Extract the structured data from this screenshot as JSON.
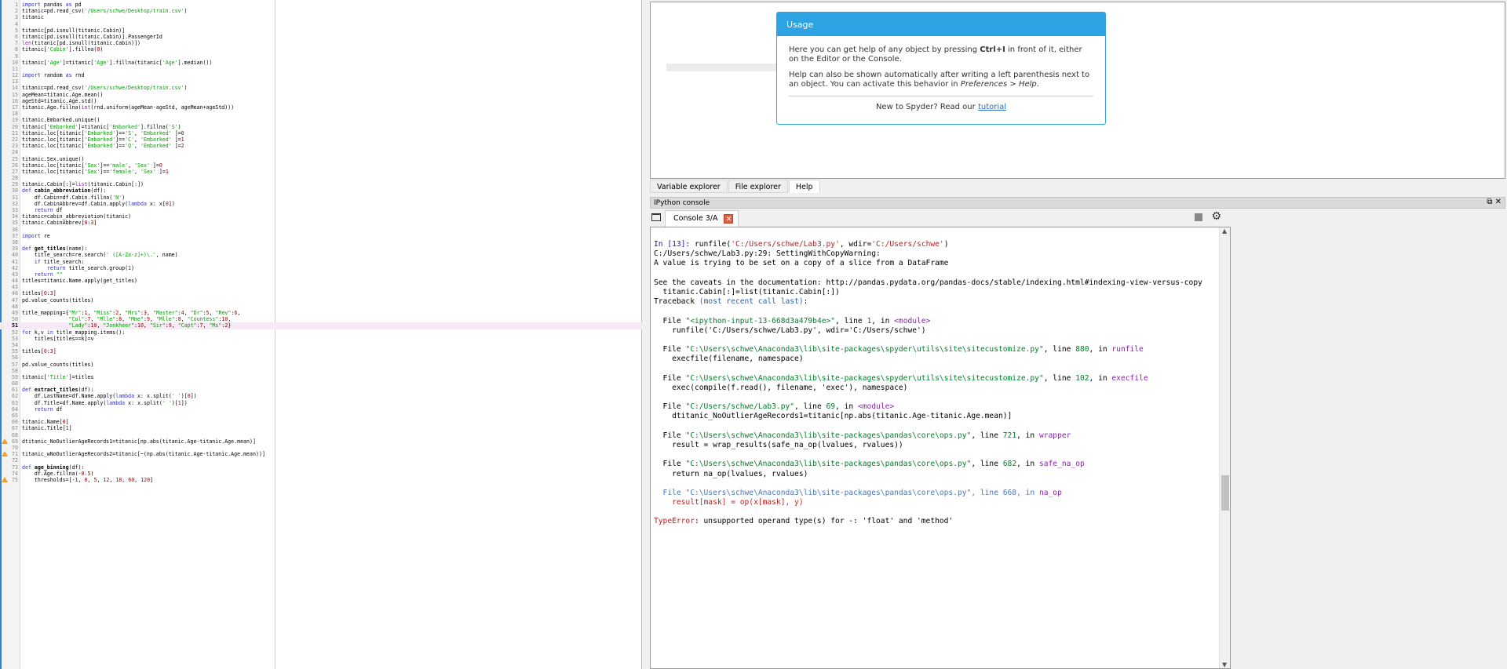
{
  "editor": {
    "current_line": 51,
    "warning_lines": [
      69,
      71,
      75
    ],
    "lines": [
      "import pandas as pd",
      "titanic=pd.read_csv('/Users/schwe/Desktop/train.csv')",
      "titanic",
      "",
      "titanic[pd.isnull(titanic.Cabin)]",
      "titanic[pd.isnull(titanic.Cabin)].PassengerId",
      "len(titanic[pd.isnull(titanic.Cabin)])",
      "titanic['Cabin'].fillna(0)",
      "",
      "titanic['Age']=titanic['Age'].fillna(titanic['Age'].median())",
      "",
      "import random as rnd",
      "",
      "titanic=pd.read_csv('/Users/schwe/Desktop/train.csv')",
      "ageMean=titanic.Age.mean()",
      "ageStd=titanic.Age.std()",
      "titanic.Age.fillna(int(rnd.uniform(ageMean-ageStd, ageMean+ageStd)))",
      "",
      "titanic.Embarked.unique()",
      "titanic['Embarked']=titanic['Embarked'].fillna('S')",
      "titanic.loc[titanic['Embarked']=='S', 'Embarked' ]=0",
      "titanic.loc[titanic['Embarked']=='C', 'Embarked' ]=1",
      "titanic.loc[titanic['Embarked']=='Q', 'Embarked' ]=2",
      "",
      "titanic.Sex.unique()",
      "titanic.loc[titanic['Sex']=='male', 'Sex' ]=0",
      "titanic.loc[titanic['Sex']=='female', 'Sex' ]=1",
      "",
      "titanic.Cabin[:]=list(titanic.Cabin[:])",
      "def cabin_abbreviation(df):",
      "    df.Cabin=df.Cabin.fillna('N')",
      "    df.CabinAbbrev=df.Cabin.apply(lambda x: x[0])",
      "    return df",
      "titanic=cabin_abbreviation(titanic)",
      "titanic.CabinAbbrev[0:3]",
      "",
      "import re",
      "",
      "def get_titles(name):",
      "    title_search=re.search(' ([A-Za-z]+)\\.', name)",
      "    if title_search:",
      "        return title_search.group(1)",
      "    return \"\"",
      "titles=titanic.Name.apply(get_titles)",
      "",
      "titles[0:3]",
      "pd.value_counts(titles)",
      "",
      "title_mapping={\"Mr\":1, \"Miss\":2, \"Mrs\":3, \"Master\":4, \"Dr\":5, \"Rev\":6,",
      "               \"Col\":7, \"Mlle\":8, \"Mme\":9, \"Mlle\":8, \"Countess\":10,",
      "               \"Lady\":10, \"Jonkheer\":10, \"Sir\":9, \"Capt\":7, \"Ms\":2}",
      "for k,v in title_mapping.items():",
      "    titles[titles==k]=v",
      "",
      "titles[0:3]",
      "",
      "pd.value_counts(titles)",
      "",
      "titanic['Title']=titles",
      "",
      "def extract_titles(df):",
      "    df.LastName=df.Name.apply(lambda x: x.split(' ')[0])",
      "    df.Title=df.Name.apply(lambda x: x.split(' ')[1])",
      "    return df",
      "",
      "titanic.Name[0]",
      "titanic.Title[1]",
      "",
      "dtitanic_NoOutlierAgeRecords1=titanic[np.abs(titanic.Age-titanic.Age.mean)]",
      "",
      "titanic_wNoOutlierAgeRecords2=titanic[~(np.abs(titanic.Age-titanic.Age.mean))]",
      "",
      "def age_binning(df):",
      "    df.Age.fillna(-0.5)",
      "    thresholds=[-1, 0, 5, 12, 18, 60, 120]"
    ]
  },
  "help": {
    "usage_title": "Usage",
    "para1_a": "Here you can get help of any object by pressing ",
    "para1_key": "Ctrl+I",
    "para1_b": " in front of it, either on the Editor or the Console.",
    "para2_a": "Help can also be shown automatically after writing a left parenthesis next to an object. You can activate this behavior in ",
    "para2_pref": "Preferences > Help",
    "para2_b": ".",
    "footer_text": "New to Spyder? Read our ",
    "footer_link": "tutorial",
    "accent": "#2ea3e3"
  },
  "tabs": [
    "Variable explorer",
    "File explorer",
    "Help"
  ],
  "ipython": {
    "title": "IPython console",
    "console_tab": "Console 3/A",
    "lines": [
      [
        [
          "In [",
          "#1a1aa6"
        ],
        [
          "13",
          "#1a1aa6"
        ],
        [
          "]: ",
          "#1a1aa6"
        ],
        [
          "runfile(",
          ""
        ],
        [
          "'C:/Users/schwe/Lab3.py'",
          "#c02020"
        ],
        [
          ", wdir=",
          ""
        ],
        [
          "'C:/Users/schwe'",
          "#c02020"
        ],
        [
          ")",
          ""
        ]
      ],
      [
        [
          "C:/Users/schwe/Lab3.py:29: SettingWithCopyWarning:",
          ""
        ]
      ],
      [
        [
          "A value is trying to be set on a copy of a slice from a DataFrame",
          ""
        ]
      ],
      [],
      [
        [
          "See the caveats in the documentation: http://pandas.pydata.org/pandas-docs/stable/indexing.html#indexing-view-versus-copy",
          ""
        ]
      ],
      [
        [
          "  titanic.Cabin[:]=list(titanic.Cabin[:])",
          ""
        ]
      ],
      [
        [
          "Traceback ",
          ""
        ],
        [
          "(most recent call last)",
          "#3060b0"
        ],
        [
          ":",
          ""
        ]
      ],
      [],
      [
        [
          "  File ",
          ""
        ],
        [
          "\"<ipython-input-13-668d3a479b4e>\"",
          "#00802b"
        ],
        [
          ", line ",
          ""
        ],
        [
          "1",
          "#00802b"
        ],
        [
          ", in ",
          ""
        ],
        [
          "<module>",
          "#9020b0"
        ]
      ],
      [
        [
          "    runfile('C:/Users/schwe/Lab3.py', wdir='C:/Users/schwe')",
          ""
        ]
      ],
      [],
      [
        [
          "  File ",
          ""
        ],
        [
          "\"C:\\Users\\schwe\\Anaconda3\\lib\\site-packages\\spyder\\utils\\site\\sitecustomize.py\"",
          "#00802b"
        ],
        [
          ", line ",
          ""
        ],
        [
          "880",
          "#00802b"
        ],
        [
          ", in ",
          ""
        ],
        [
          "runfile",
          "#9020b0"
        ]
      ],
      [
        [
          "    execfile(filename, namespace)",
          ""
        ]
      ],
      [],
      [
        [
          "  File ",
          ""
        ],
        [
          "\"C:\\Users\\schwe\\Anaconda3\\lib\\site-packages\\spyder\\utils\\site\\sitecustomize.py\"",
          "#00802b"
        ],
        [
          ", line ",
          ""
        ],
        [
          "102",
          "#00802b"
        ],
        [
          ", in ",
          ""
        ],
        [
          "execfile",
          "#9020b0"
        ]
      ],
      [
        [
          "    exec(compile(f.read(), filename, 'exec'), namespace)",
          ""
        ]
      ],
      [],
      [
        [
          "  File ",
          ""
        ],
        [
          "\"C:/Users/schwe/Lab3.py\"",
          "#00802b"
        ],
        [
          ", line ",
          ""
        ],
        [
          "69",
          "#00802b"
        ],
        [
          ", in ",
          ""
        ],
        [
          "<module>",
          "#9020b0"
        ]
      ],
      [
        [
          "    dtitanic_NoOutlierAgeRecords1=titanic[np.abs(titanic.Age-titanic.Age.mean)]",
          ""
        ]
      ],
      [],
      [
        [
          "  File ",
          ""
        ],
        [
          "\"C:\\Users\\schwe\\Anaconda3\\lib\\site-packages\\pandas\\core\\ops.py\"",
          "#00802b"
        ],
        [
          ", line ",
          ""
        ],
        [
          "721",
          "#00802b"
        ],
        [
          ", in ",
          ""
        ],
        [
          "wrapper",
          "#9020b0"
        ]
      ],
      [
        [
          "    result = wrap_results(safe_na_op(lvalues, rvalues))",
          ""
        ]
      ],
      [],
      [
        [
          "  File ",
          ""
        ],
        [
          "\"C:\\Users\\schwe\\Anaconda3\\lib\\site-packages\\pandas\\core\\ops.py\"",
          "#00802b"
        ],
        [
          ", line ",
          ""
        ],
        [
          "682",
          "#00802b"
        ],
        [
          ", in ",
          ""
        ],
        [
          "safe_na_op",
          "#9020b0"
        ]
      ],
      [
        [
          "    return na_op(lvalues, rvalues)",
          ""
        ]
      ],
      [],
      [
        [
          "  File \"C:\\Users\\schwe\\Anaconda3\\lib\\site-packages\\pandas\\core\\ops.py\", line 668, in ",
          "#4a78b8"
        ],
        [
          "na_op",
          "#9020b0"
        ]
      ],
      [
        [
          "    result[mask] = op(x[mask], y)",
          "#c02020"
        ]
      ],
      [],
      [
        [
          "TypeError",
          "#c02020"
        ],
        [
          ": unsupported operand type(s) for -: 'float' and 'method'",
          ""
        ]
      ]
    ]
  }
}
